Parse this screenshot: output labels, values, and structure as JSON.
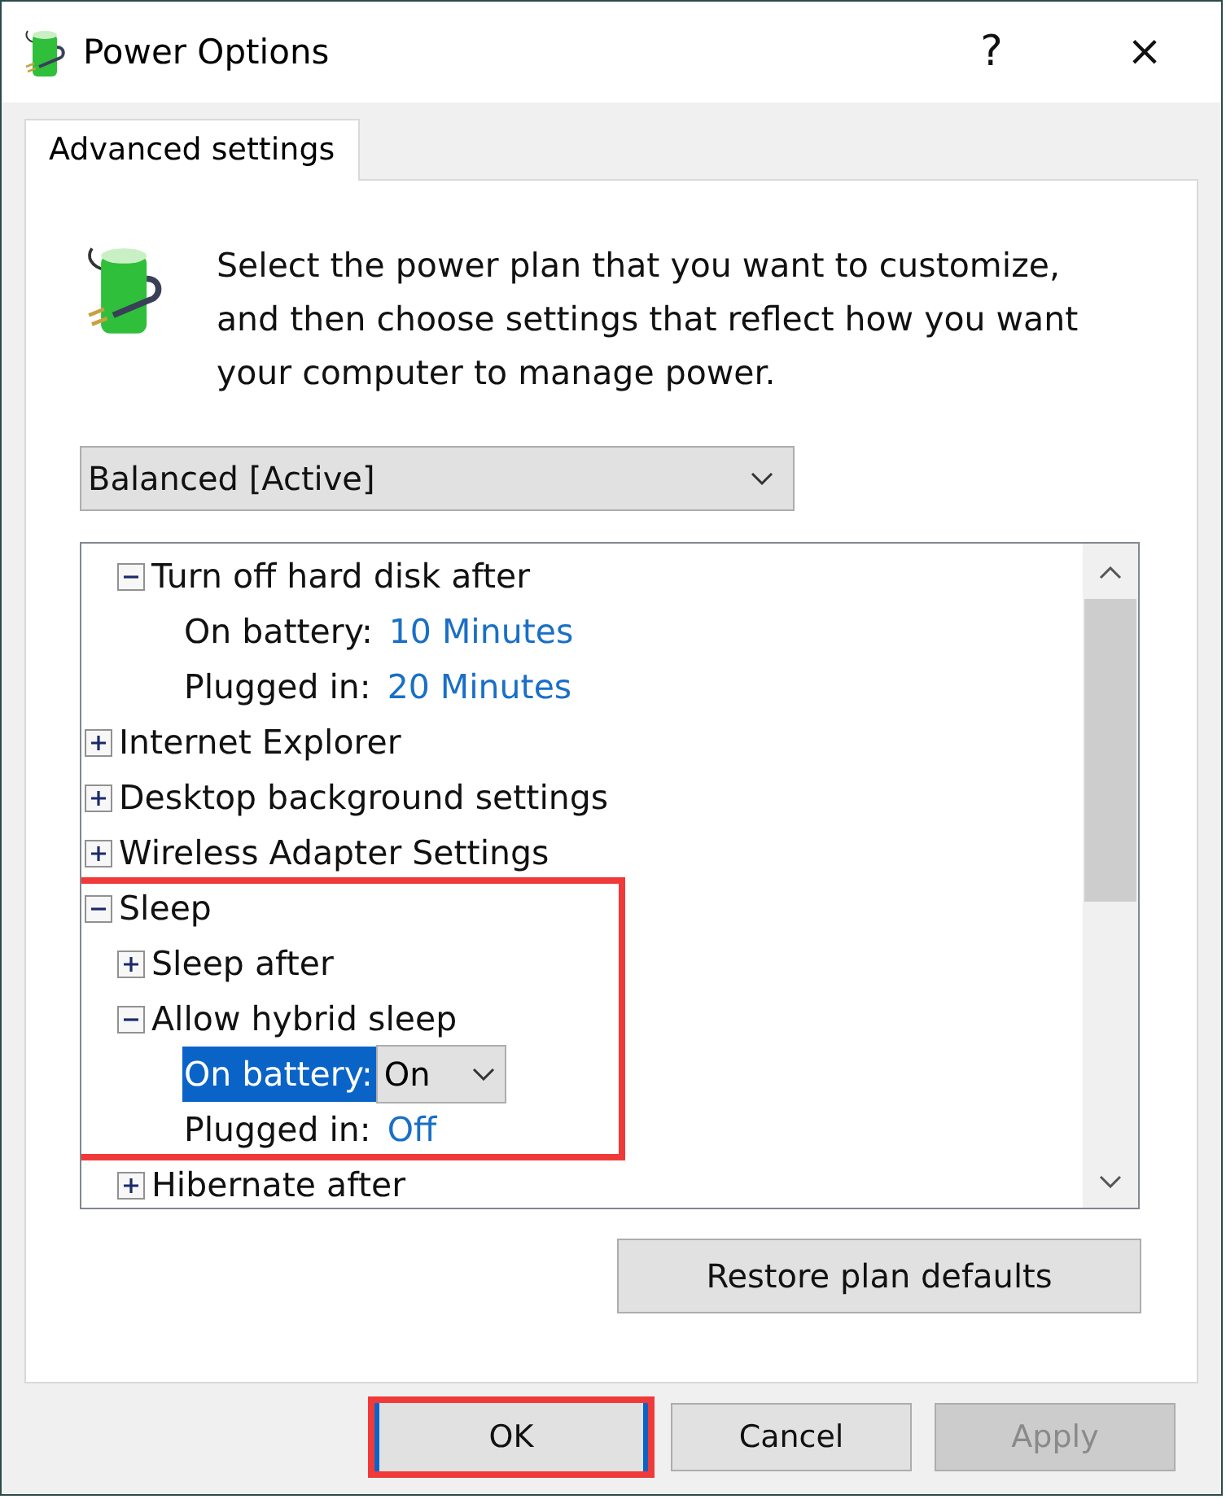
{
  "window": {
    "title": "Power Options",
    "help": "?",
    "close": "×"
  },
  "tabs": [
    {
      "label": "Advanced settings",
      "selected": true
    }
  ],
  "intro": "Select the power plan that you want to customize, and then choose settings that reflect how you want your computer to manage power.",
  "plan_dropdown": {
    "value": "Balanced [Active]"
  },
  "tree": [
    {
      "kind": "offscreen-parent",
      "children": [
        {
          "kind": "group",
          "label": "Turn off hard disk after",
          "expanded": true,
          "highlighted": false,
          "children": [
            {
              "kind": "setting",
              "label": "On battery:",
              "value": "10 Minutes",
              "selected": false
            },
            {
              "kind": "setting",
              "label": "Plugged in:",
              "value": "20 Minutes",
              "selected": false
            }
          ]
        }
      ]
    },
    {
      "kind": "group",
      "label": "Internet Explorer",
      "expanded": false,
      "highlighted": false
    },
    {
      "kind": "group",
      "label": "Desktop background settings",
      "expanded": false,
      "highlighted": false
    },
    {
      "kind": "group",
      "label": "Wireless Adapter Settings",
      "expanded": false,
      "highlighted": false
    },
    {
      "kind": "group",
      "label": "Sleep",
      "expanded": true,
      "highlighted": true,
      "children": [
        {
          "kind": "group",
          "label": "Sleep after",
          "expanded": false,
          "highlighted": false
        },
        {
          "kind": "group",
          "label": "Allow hybrid sleep",
          "expanded": true,
          "highlighted": false,
          "children": [
            {
              "kind": "setting",
              "label": "On battery:",
              "value": "On",
              "selected": true
            },
            {
              "kind": "setting",
              "label": "Plugged in:",
              "value": "Off",
              "selected": false
            }
          ]
        },
        {
          "kind": "group",
          "label": "Hibernate after",
          "expanded": false,
          "highlighted": false
        }
      ]
    }
  ],
  "restore_button": "Restore plan defaults",
  "buttons": [
    {
      "label": "OK",
      "default": true,
      "highlighted": true,
      "disabled": false
    },
    {
      "label": "Cancel",
      "default": false,
      "highlighted": false,
      "disabled": false
    },
    {
      "label": "Apply",
      "default": false,
      "highlighted": false,
      "disabled": true
    }
  ]
}
